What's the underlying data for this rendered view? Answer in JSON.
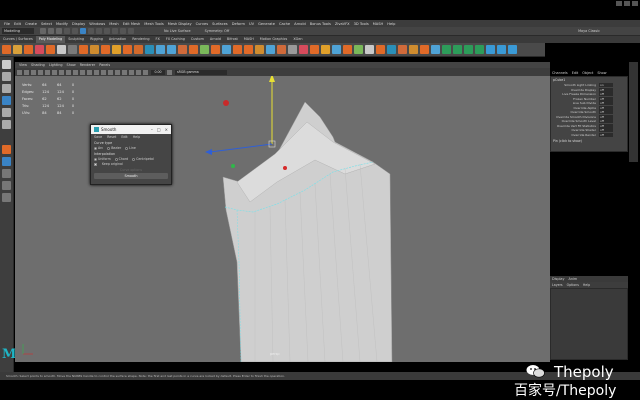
{
  "app": {
    "menubar": [
      "File",
      "Edit",
      "Create",
      "Select",
      "Modify",
      "Display",
      "Windows",
      "Mesh",
      "Edit Mesh",
      "Mesh Tools",
      "Mesh Display",
      "Curves",
      "Surfaces",
      "Deform",
      "UV",
      "Generate",
      "Cache",
      "Arnold",
      "Bonus Tools",
      "ZivaVFX",
      "3D Tools",
      "MASH",
      "Help"
    ],
    "mode": "Modeling",
    "no_live_surface": "No Live Surface",
    "symmetry": "Symmetry: Off",
    "workspace": "Maya Classic"
  },
  "shelf": {
    "tabs": [
      "Curves / Surfaces",
      "Poly Modeling",
      "Sculpting",
      "Rigging",
      "Animation",
      "Rendering",
      "FX",
      "FX Caching",
      "Custom",
      "Arnold",
      "Bifrost",
      "MASH",
      "Motion Graphics",
      "XGen"
    ],
    "active_tab": "Poly Modeling",
    "icon_colors": [
      "#e06a28",
      "#d8a03a",
      "#e06a28",
      "#d64b5c",
      "#e06a28",
      "#c9c9c9",
      "#7a7a7a",
      "#e06a28",
      "#cf8c2f",
      "#e06a28",
      "#e0a02a",
      "#e06a28",
      "#d36a2b",
      "#2a8fb8",
      "#4fa3d6",
      "#4fa3d6",
      "#d06a3a",
      "#e06a28",
      "#7ab85a",
      "#e06a28",
      "#4fa3d6",
      "#e06a28",
      "#e06a28",
      "#cf8c2f",
      "#4fa3d6",
      "#d06a3a",
      "#9a9a9a",
      "#d64b5c",
      "#e06a28",
      "#e0a02a",
      "#4fa3d6",
      "#e06a28",
      "#7ab85a",
      "#c9c9c9",
      "#e06a28",
      "#2a8fb8",
      "#d06a3a",
      "#cf8c2f",
      "#e06a28",
      "#4fa3d6",
      "#2d9c5a",
      "#2d9c5a",
      "#2d9c5a",
      "#2d9c5a",
      "#3a9ad6",
      "#3a9ad6",
      "#3a9ad6"
    ]
  },
  "viewport": {
    "menu": [
      "View",
      "Shading",
      "Lighting",
      "Show",
      "Renderer",
      "Panels"
    ],
    "field_value": "0.00",
    "camera_select": "sRGB gamma",
    "camera_label": "persp",
    "hud": [
      {
        "label": "Verts:",
        "a": "64",
        "b": "64",
        "c": "0"
      },
      {
        "label": "Edges:",
        "a": "124",
        "b": "124",
        "c": "0"
      },
      {
        "label": "Faces:",
        "a": "62",
        "b": "62",
        "c": "0"
      },
      {
        "label": "Tris:",
        "a": "124",
        "b": "124",
        "c": "0"
      },
      {
        "label": "UVs:",
        "a": "84",
        "b": "84",
        "c": "0"
      }
    ]
  },
  "dialog": {
    "title": "Smooth",
    "menu": [
      "Save",
      "Reset",
      "Edit",
      "Help"
    ],
    "curve_type_label": "Curve type",
    "curve_types": [
      "Arc",
      "Bezier",
      "Line"
    ],
    "attr_label": "Interpolation",
    "attr_opts": [
      "Uniform",
      "Chord",
      "Centripetal"
    ],
    "keep_original": "Keep original",
    "disabled_hint": "Curve options",
    "apply_button": "Smooth"
  },
  "right_panel": {
    "tabs": [
      "Channels",
      "Edit",
      "Object",
      "Show"
    ],
    "object_name": "pCube1",
    "subtitle": "pCubeShape1",
    "rows": [
      {
        "k": "Smooth Light Linking",
        "v": "on"
      },
      {
        "k": "Override Display",
        "v": "off"
      },
      {
        "k": "Live Freeze Dimension",
        "v": "off"
      },
      {
        "k": "Frozen Number",
        "v": "off"
      },
      {
        "k": "Live Sub Divide",
        "v": "off"
      },
      {
        "k": "Override Alpha",
        "v": "off"
      },
      {
        "k": "Override Smooth",
        "v": "off"
      },
      {
        "k": "Override Smooth Divisions",
        "v": "off"
      },
      {
        "k": "Override Smooth Level",
        "v": "off"
      },
      {
        "k": "Override Vert Fit Statistics",
        "v": "off"
      },
      {
        "k": "Override Shader",
        "v": "off"
      },
      {
        "k": "Override Render",
        "v": "off"
      }
    ],
    "shape_label": "Pin (click to show)",
    "lower_tabs": [
      "Display",
      "Anim"
    ],
    "lower_menu": [
      "Layers",
      "Options",
      "Help"
    ]
  },
  "status_line": "Smooth: Select points to smooth. Move the NURBS handle to control the surface shape. Note: the first and last points in a curve are locked by default. Press Enter to finish the operation.",
  "watermark": {
    "line1": "Thepoly",
    "line2": "百家号/Thepoly"
  },
  "colors": {
    "accent": "#1fb6c6",
    "viewport_bg": "#6e6e6e",
    "mesh": "#cfcfcf"
  }
}
